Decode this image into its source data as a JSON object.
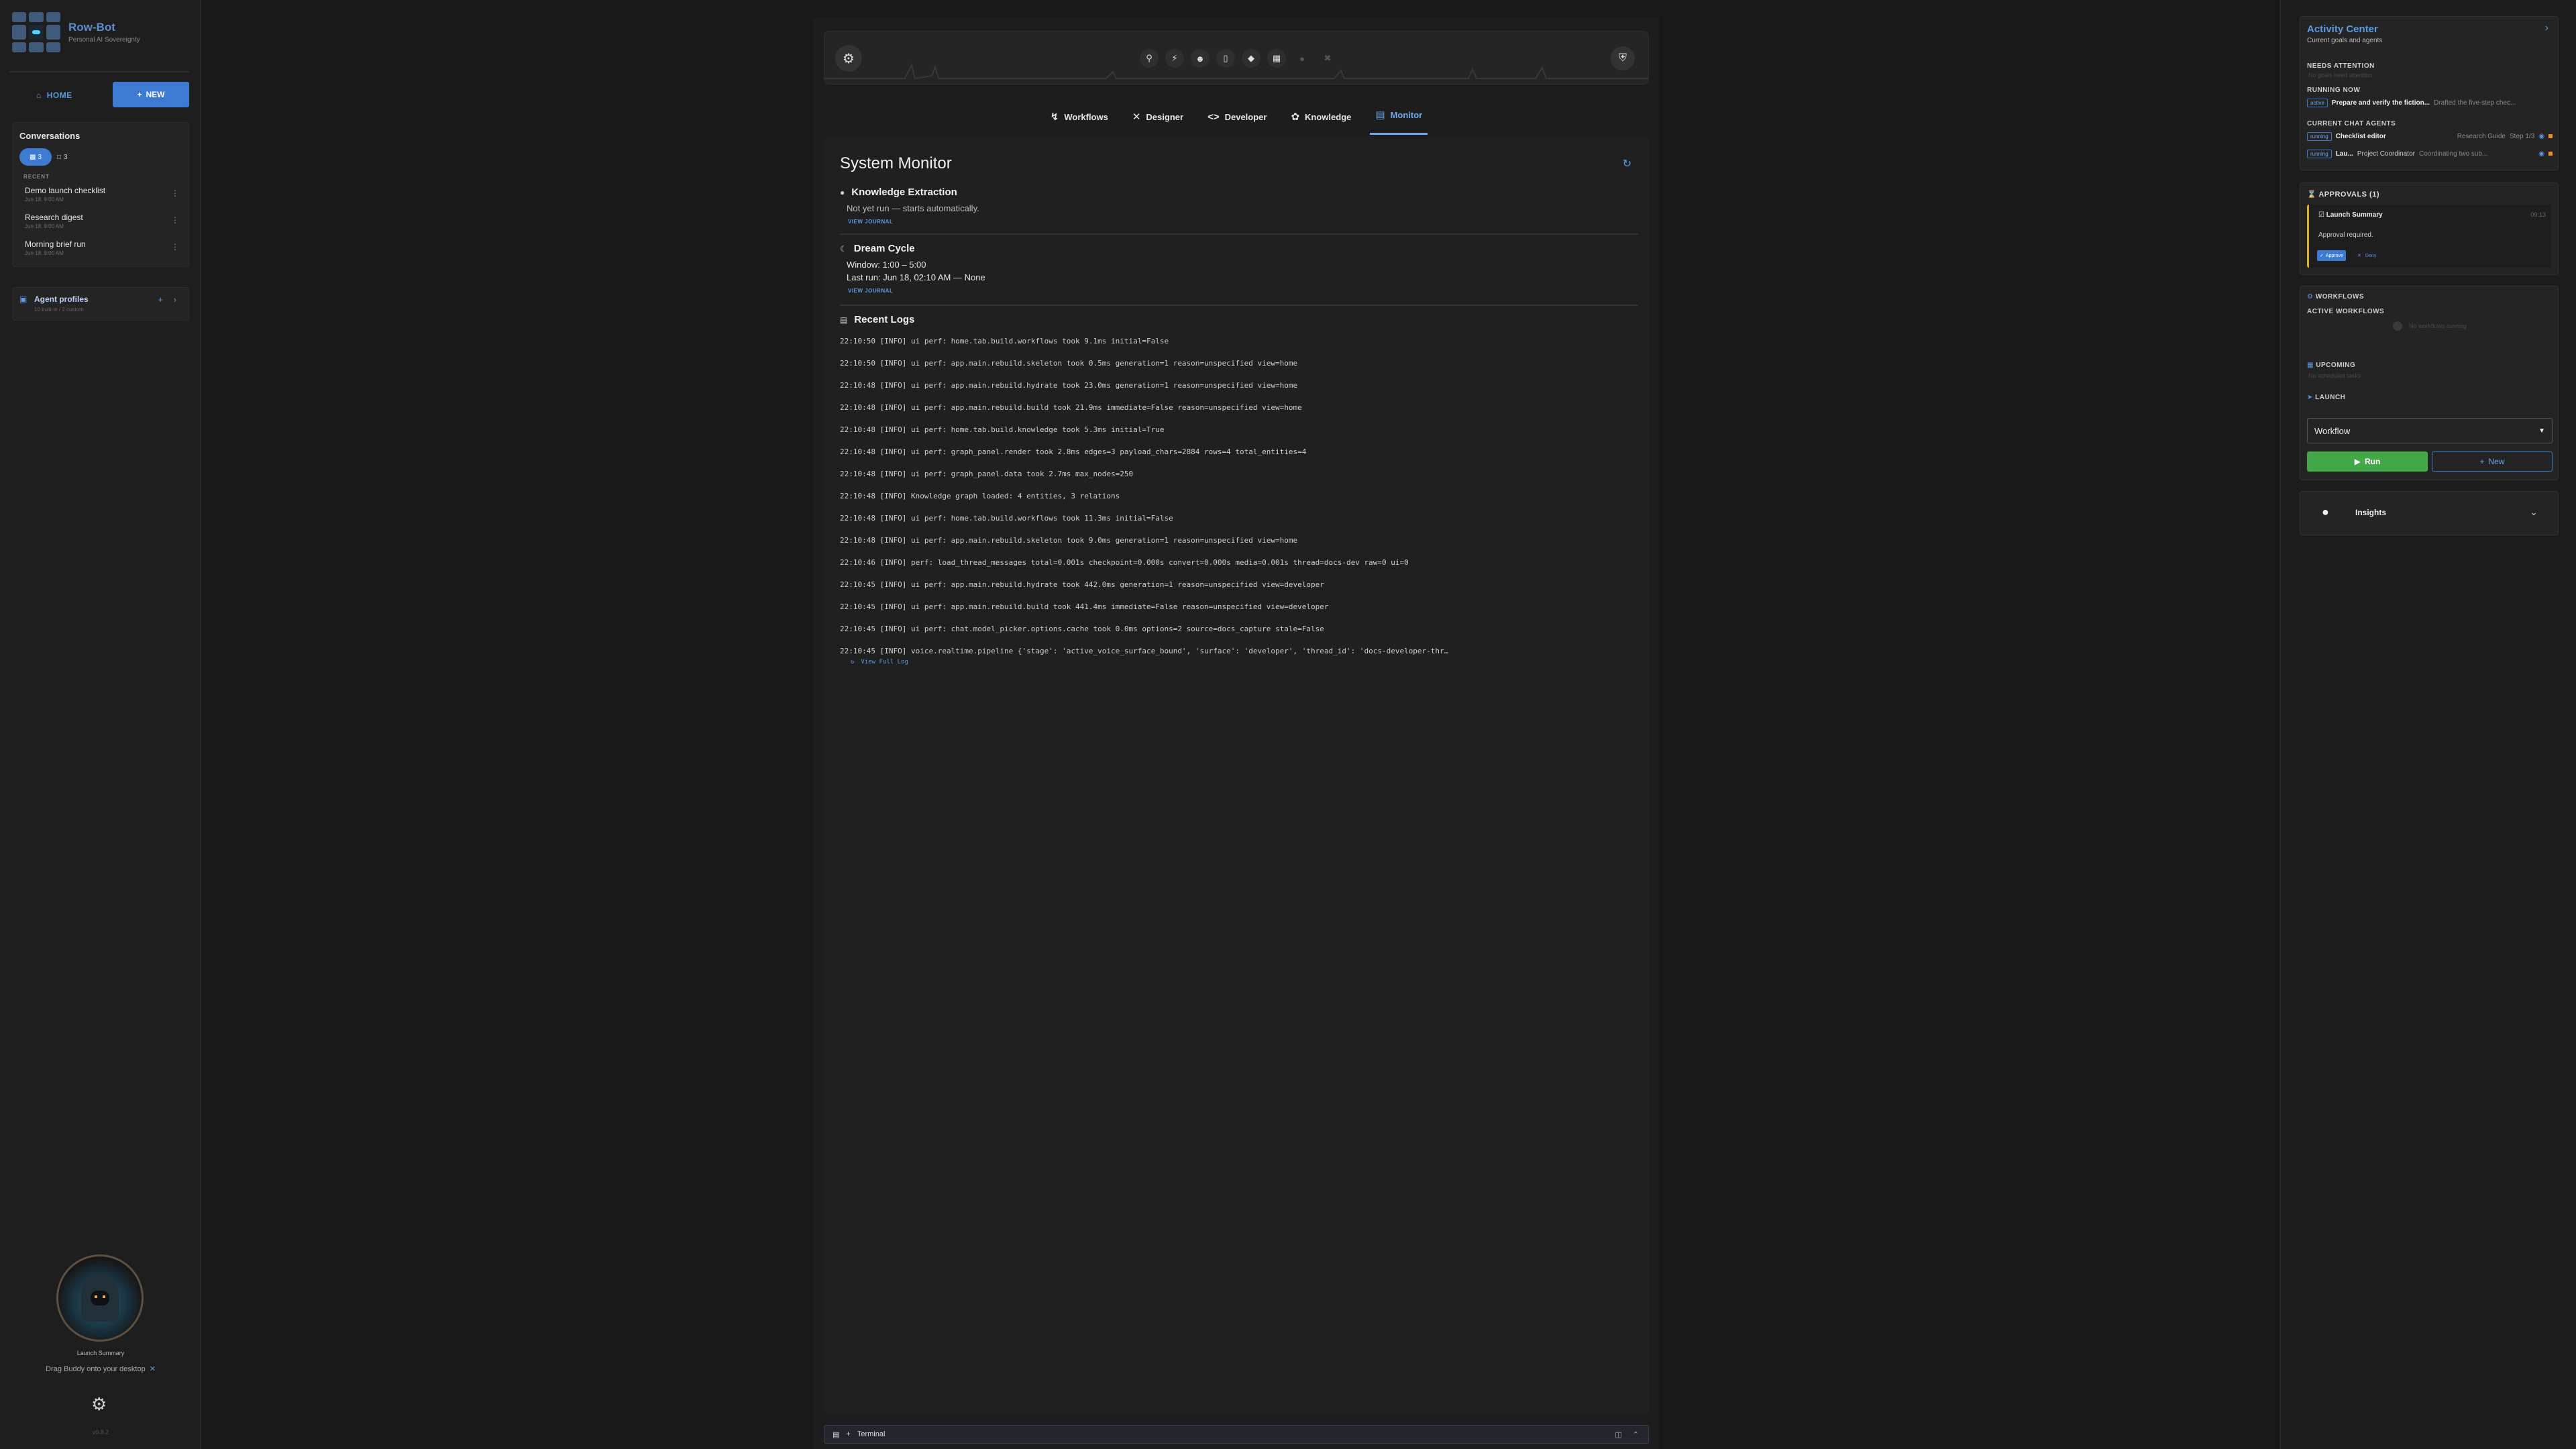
{
  "app": {
    "name": "Row-Bot",
    "subtitle": "Personal AI Sovereignty",
    "version": "v0.8.2"
  },
  "sidebar": {
    "home_label": "HOME",
    "new_label": "NEW",
    "conversations": {
      "title": "Conversations",
      "active_count": "3",
      "chat_count": "3",
      "recent_label": "RECENT",
      "items": [
        {
          "name": "Demo launch checklist",
          "date": "Jun 18, 9:00 AM"
        },
        {
          "name": "Research digest",
          "date": "Jun 18, 9:00 AM"
        },
        {
          "name": "Morning brief run",
          "date": "Jun 18, 9:00 AM"
        }
      ]
    },
    "agent_profiles": {
      "title": "Agent profiles",
      "subtitle": "10 built-in / 2 custom"
    },
    "buddy": {
      "caption": "Launch Summary",
      "drag_text": "Drag Buddy onto your desktop"
    }
  },
  "nav": {
    "tabs": [
      {
        "label": "Workflows",
        "icon": "bolt-icon"
      },
      {
        "label": "Designer",
        "icon": "tools-icon"
      },
      {
        "label": "Developer",
        "icon": "code-icon"
      },
      {
        "label": "Knowledge",
        "icon": "brain-icon"
      },
      {
        "label": "Monitor",
        "icon": "monitor-icon",
        "active": true
      }
    ]
  },
  "monitor": {
    "title": "System Monitor",
    "knowledge_extraction": {
      "title": "Knowledge Extraction",
      "status": "Not yet run — starts automatically.",
      "link": "VIEW JOURNAL"
    },
    "dream_cycle": {
      "title": "Dream Cycle",
      "window": "Window: 1:00 – 5:00",
      "last_run": "Last run: Jun 18, 02:10 AM — None",
      "link": "VIEW JOURNAL"
    },
    "logs": {
      "title": "Recent Logs",
      "full_log_label": "View Full Log",
      "lines": [
        "22:10:50 [INFO] ui perf: home.tab.build.workflows took 9.1ms initial=False",
        "22:10:50 [INFO] ui perf: app.main.rebuild.skeleton took 0.5ms generation=1 reason=unspecified view=home",
        "22:10:48 [INFO] ui perf: app.main.rebuild.hydrate took 23.0ms generation=1 reason=unspecified view=home",
        "22:10:48 [INFO] ui perf: app.main.rebuild.build took 21.9ms immediate=False reason=unspecified view=home",
        "22:10:48 [INFO] ui perf: home.tab.build.knowledge took 5.3ms initial=True",
        "22:10:48 [INFO] ui perf: graph_panel.render took 2.8ms edges=3 payload_chars=2884 rows=4 total_entities=4",
        "22:10:48 [INFO] ui perf: graph_panel.data took 2.7ms max_nodes=250",
        "22:10:48 [INFO] Knowledge graph loaded: 4 entities, 3 relations",
        "22:10:48 [INFO] ui perf: home.tab.build.workflows took 11.3ms initial=False",
        "22:10:48 [INFO] ui perf: app.main.rebuild.skeleton took 9.0ms generation=1 reason=unspecified view=home",
        "22:10:46 [INFO] perf: load_thread_messages total=0.001s checkpoint=0.000s convert=0.000s media=0.001s thread=docs-dev raw=0 ui=0",
        "22:10:45 [INFO] ui perf: app.main.rebuild.hydrate took 442.0ms generation=1 reason=unspecified view=developer",
        "22:10:45 [INFO] ui perf: app.main.rebuild.build took 441.4ms immediate=False reason=unspecified view=developer",
        "22:10:45 [INFO] ui perf: chat.model_picker.options.cache took 0.0ms options=2 source=docs_capture stale=False",
        "22:10:45 [INFO] voice.realtime.pipeline {'stage': 'active_voice_surface_bound', 'surface': 'developer', 'thread_id': 'docs-developer-thr…"
      ]
    }
  },
  "terminal": {
    "label": "Terminal"
  },
  "activity_center": {
    "title": "Activity Center",
    "subtitle": "Current goals and agents",
    "needs_attention": {
      "label": "NEEDS ATTENTION",
      "empty": "No goals need attention"
    },
    "running_now": {
      "label": "RUNNING NOW",
      "items": [
        {
          "tag": "active",
          "name": "Prepare and verify the fiction...",
          "detail": "Drafted the five-step chec..."
        }
      ]
    },
    "current_chat_agents": {
      "label": "CURRENT CHAT AGENTS",
      "items": [
        {
          "tag": "running",
          "name": "Checklist editor",
          "detail": "Research Guide",
          "step": "Step 1/3"
        },
        {
          "tag": "running",
          "name": "Lau...",
          "detail": "Project Coordinator",
          "step": "Coordinating two sub..."
        }
      ]
    }
  },
  "approvals": {
    "label": "APPROVALS (1)",
    "item": {
      "title": "Launch Summary",
      "time": "09:13",
      "text": "Approval required.",
      "approve": "Approve",
      "deny": "Deny"
    }
  },
  "workflows": {
    "label": "WORKFLOWS",
    "active_label": "ACTIVE WORKFLOWS",
    "active_empty": "No workflows running",
    "upcoming_label": "UPCOMING",
    "upcoming_empty": "No scheduled tasks",
    "launch_label": "LAUNCH",
    "select_value": "Workflow",
    "run_label": "Run",
    "new_label": "New"
  },
  "insights": {
    "label": "Insights"
  },
  "colors": {
    "accent": "#3d7ad1",
    "run_green": "#43a847",
    "approval_bar": "#e0b12a"
  }
}
